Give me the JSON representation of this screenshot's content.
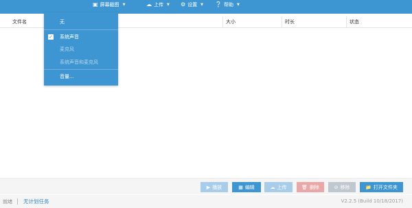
{
  "toolbar": {
    "items": [
      {
        "label": "屏幕截图",
        "icon": "camera-icon"
      },
      {
        "label": "上传",
        "icon": "cloud-upload-icon"
      },
      {
        "label": "设置",
        "icon": "gear-icon"
      },
      {
        "label": "帮助",
        "icon": "help-icon"
      }
    ],
    "background": "#3d96d1"
  },
  "table": {
    "columns": [
      "文件名",
      "大小",
      "时长",
      "状态"
    ],
    "rows": []
  },
  "dropdown": {
    "items": [
      {
        "label": "无",
        "checked": false,
        "disabled": false
      },
      {
        "label": "系统声音",
        "checked": true,
        "disabled": false
      },
      {
        "label": "麦克风",
        "checked": false,
        "disabled": true
      },
      {
        "label": "系统声音和麦克风",
        "checked": false,
        "disabled": true
      },
      {
        "label": "音量...",
        "checked": false,
        "disabled": false
      }
    ]
  },
  "actions": {
    "play": "播放",
    "edit": "编辑",
    "upload": "上传",
    "delete": "删除",
    "move": "移除",
    "open_folder": "打开文件夹"
  },
  "status": {
    "ready": "就绪",
    "task": "无计划任务",
    "version": "V2.2.5 (Build 10/18/2017)"
  },
  "colors": {
    "accent": "#3d96d1",
    "delete": "#e8a8a8",
    "disabled_button": "#a7cdea"
  }
}
